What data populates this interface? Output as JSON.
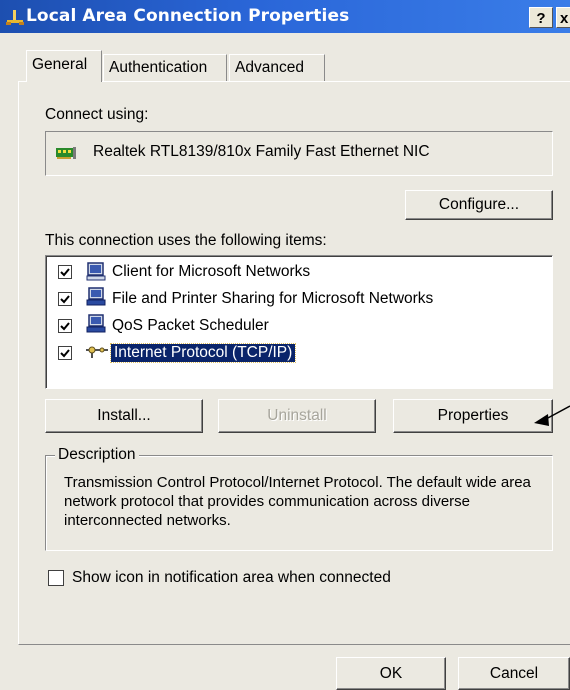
{
  "window": {
    "title": "Local Area Connection Properties",
    "help_label": "?",
    "close_label": "x"
  },
  "tabs": [
    {
      "label": "General",
      "active": true
    },
    {
      "label": "Authentication",
      "active": false
    },
    {
      "label": "Advanced",
      "active": false
    }
  ],
  "general": {
    "connect_using_label": "Connect using:",
    "adapter_name": "Realtek RTL8139/810x Family Fast Ethernet NIC",
    "configure_label": "Configure...",
    "items_label": "This connection uses the following items:",
    "items": [
      {
        "label": "Client for Microsoft Networks",
        "checked": true,
        "icon": "network-client-icon"
      },
      {
        "label": "File and Printer Sharing for Microsoft Networks",
        "checked": true,
        "icon": "file-printer-sharing-icon"
      },
      {
        "label": "QoS Packet Scheduler",
        "checked": true,
        "icon": "qos-scheduler-icon"
      },
      {
        "label": "Internet Protocol (TCP/IP)",
        "checked": true,
        "icon": "protocol-icon",
        "selected": true
      }
    ],
    "install_label": "Install...",
    "uninstall_label": "Uninstall",
    "properties_label": "Properties",
    "description_title": "Description",
    "description_text": "Transmission Control Protocol/Internet Protocol. The default wide area network protocol that provides communication across diverse interconnected networks.",
    "notify_label": "Show icon in notification area when connected",
    "notify_checked": false
  },
  "footer": {
    "ok_label": "OK",
    "cancel_label": "Cancel"
  },
  "colors": {
    "titlebar": "#2a66d8",
    "dialog_bg": "#ebe9e1",
    "selection": "#0a246a"
  }
}
